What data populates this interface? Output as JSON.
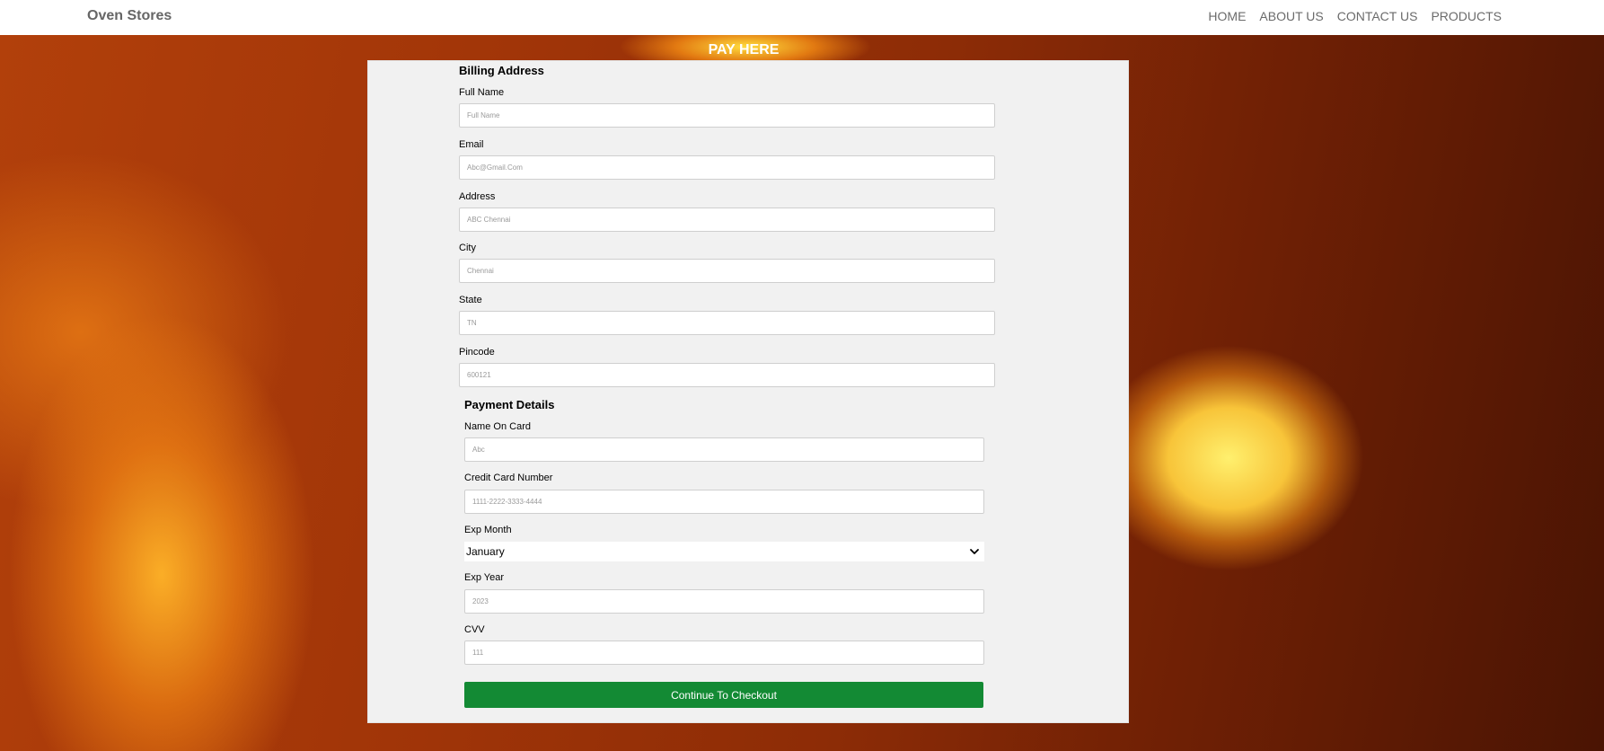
{
  "navbar": {
    "brand": "Oven Stores",
    "links": [
      "HOME",
      "ABOUT US",
      "CONTACT US",
      "PRODUCTS"
    ]
  },
  "page_title": "PAY HERE",
  "billing": {
    "title": "Billing Address",
    "full_name": {
      "label": "Full Name",
      "placeholder": "Full Name"
    },
    "email": {
      "label": "Email",
      "placeholder": "Abc@Gmail.Com"
    },
    "address": {
      "label": "Address",
      "placeholder": "ABC Chennai"
    },
    "city": {
      "label": "City",
      "placeholder": "Chennai"
    },
    "state": {
      "label": "State",
      "placeholder": "TN"
    },
    "pincode": {
      "label": "Pincode",
      "placeholder": "600121"
    }
  },
  "payment": {
    "title": "Payment Details",
    "name_on_card": {
      "label": "Name On Card",
      "placeholder": "Abc"
    },
    "card_number": {
      "label": "Credit Card Number",
      "placeholder": "1111-2222-3333-4444"
    },
    "exp_month": {
      "label": "Exp Month",
      "selected": "January"
    },
    "exp_year": {
      "label": "Exp Year",
      "placeholder": "2023"
    },
    "cvv": {
      "label": "CVV",
      "placeholder": "111"
    }
  },
  "checkout_button": "Continue To Checkout",
  "colors": {
    "button": "#138a34",
    "card": "#f1f1f1"
  }
}
